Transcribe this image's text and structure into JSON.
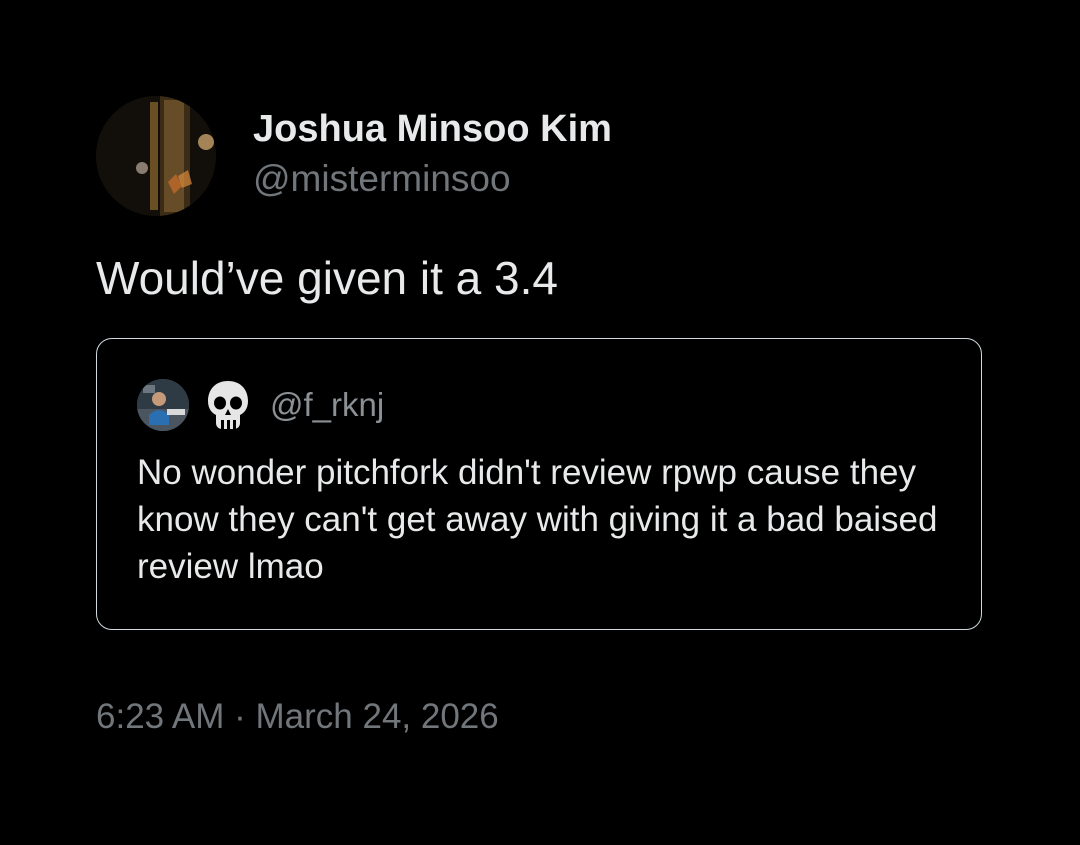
{
  "author": {
    "display_name": "Joshua Minsoo Kim",
    "handle": "@misterminsoo",
    "avatar_icon": "profile-photo"
  },
  "tweet": {
    "text": "Would’ve given it a 3.4"
  },
  "quoted_tweet": {
    "handle": "@f_rknj",
    "emoji_icon": "skull-emoji-icon",
    "text": "No wonder pitchfork didn't review rpwp cause they know they can't get away with giving it a bad baised review lmao"
  },
  "meta": {
    "timestamp": "6:23 AM · March 24, 2026"
  },
  "colors": {
    "background": "#000000",
    "primary_text": "#e7e9ea",
    "secondary_text": "#71767b",
    "card_border": "#cfd9de"
  }
}
